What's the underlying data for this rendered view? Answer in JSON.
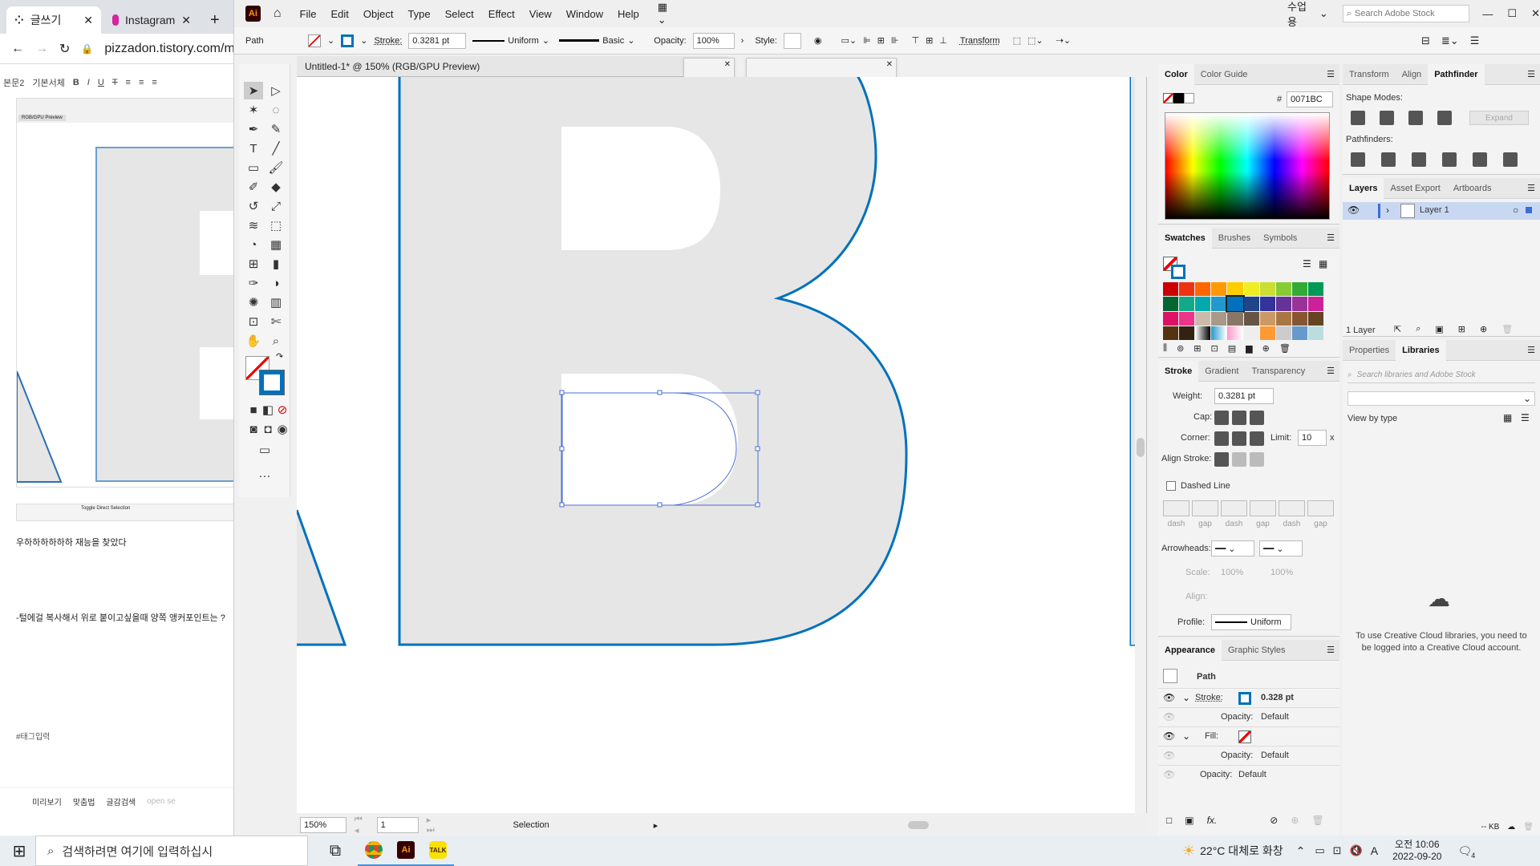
{
  "chrome": {
    "tabs": [
      {
        "title": "글쓰기"
      },
      {
        "title": "Instagram"
      }
    ],
    "new_tab": "+",
    "address": "pizzadon.tistory.com/m",
    "editor": {
      "style_menu": "기본서체",
      "size_menu": "본문2"
    },
    "blog_lines": [
      "우하하하하하하 재능을 찾았다",
      "-털에걸 복사해서 위로 붙이고싶을때 양쪽 앵커포인트는 ?",
      "#태그입력"
    ],
    "thumb_caption": "Toggle Direct Selection",
    "thumb_title": "RGB/GPU Preview",
    "footer": {
      "preview": "미리보기",
      "spell": "맞춤법",
      "save": "글감검색",
      "open": "open se"
    }
  },
  "ai": {
    "logo": "Ai",
    "menus": [
      "File",
      "Edit",
      "Object",
      "Type",
      "Select",
      "Effect",
      "View",
      "Window",
      "Help"
    ],
    "workspace": "수업용",
    "search_placeholder": "Search Adobe Stock",
    "control": {
      "object_type": "Path",
      "stroke_label": "Stroke:",
      "stroke_weight": "0.3281 pt",
      "profile_label": "Uniform",
      "brush_label": "Basic",
      "opacity_label": "Opacity:",
      "opacity_value": "100%",
      "style_label": "Style:",
      "transform_label": "Transform"
    },
    "doc_tab": "Untitled-1* @ 150% (RGB/GPU Preview)",
    "status": {
      "zoom": "150%",
      "artboard": "1",
      "tool": "Selection"
    },
    "colors": {
      "stroke": "#0071BC",
      "selection": "#4a6fd4"
    },
    "color_panel": {
      "tabs": [
        "Color",
        "Color Guide"
      ],
      "hex_label": "#",
      "hex": "0071BC"
    },
    "transform_panel": {
      "tabs": [
        "Transform",
        "Align",
        "Pathfinder"
      ],
      "shape_modes": "Shape Modes:",
      "pathfinders": "Pathfinders:",
      "expand": "Expand"
    },
    "layers_panel": {
      "tabs": [
        "Layers",
        "Asset Export",
        "Artboards"
      ],
      "layer_name": "Layer 1",
      "count": "1 Layer"
    },
    "swatches_panel": {
      "tabs": [
        "Swatches",
        "Brushes",
        "Symbols"
      ]
    },
    "stroke_panel": {
      "tabs": [
        "Stroke",
        "Gradient",
        "Transparency"
      ],
      "weight_label": "Weight:",
      "weight": "0.3281 pt",
      "cap_label": "Cap:",
      "corner_label": "Corner:",
      "limit_label": "Limit:",
      "limit": "10",
      "limit_unit": "x",
      "align_label": "Align Stroke:",
      "dashed": "Dashed Line",
      "dash_labels": [
        "dash",
        "gap",
        "dash",
        "gap",
        "dash",
        "gap"
      ],
      "arrowheads": "Arrowheads:",
      "scale_label": "Scale:",
      "scale1": "100%",
      "scale2": "100%",
      "align2_label": "Align:",
      "profile_label": "Profile:",
      "profile": "Uniform"
    },
    "props_panel": {
      "tabs": [
        "Properties",
        "Libraries"
      ],
      "search_placeholder": "Search libraries and Adobe Stock",
      "view_by": "View by type",
      "message": "To use Creative Cloud libraries, you need to be logged into a Creative Cloud account.",
      "size": "-- KB"
    },
    "appearance_panel": {
      "tabs": [
        "Appearance",
        "Graphic Styles"
      ],
      "title": "Path",
      "rows": [
        {
          "label": "Stroke:",
          "value": "0.328 pt"
        },
        {
          "label": "Opacity:",
          "value": "Default"
        },
        {
          "label": "Fill:",
          "value": ""
        },
        {
          "label": "Opacity:",
          "value": "Default"
        },
        {
          "label": "Opacity:",
          "value": "Default"
        }
      ],
      "fx": "fx."
    }
  },
  "taskbar": {
    "search_placeholder": "검색하려면 여기에 입력하십시",
    "weather": "22°C 대체로 화창",
    "time": "오전 10:06",
    "date": "2022-09-20",
    "ime": "A",
    "notif": "4"
  }
}
